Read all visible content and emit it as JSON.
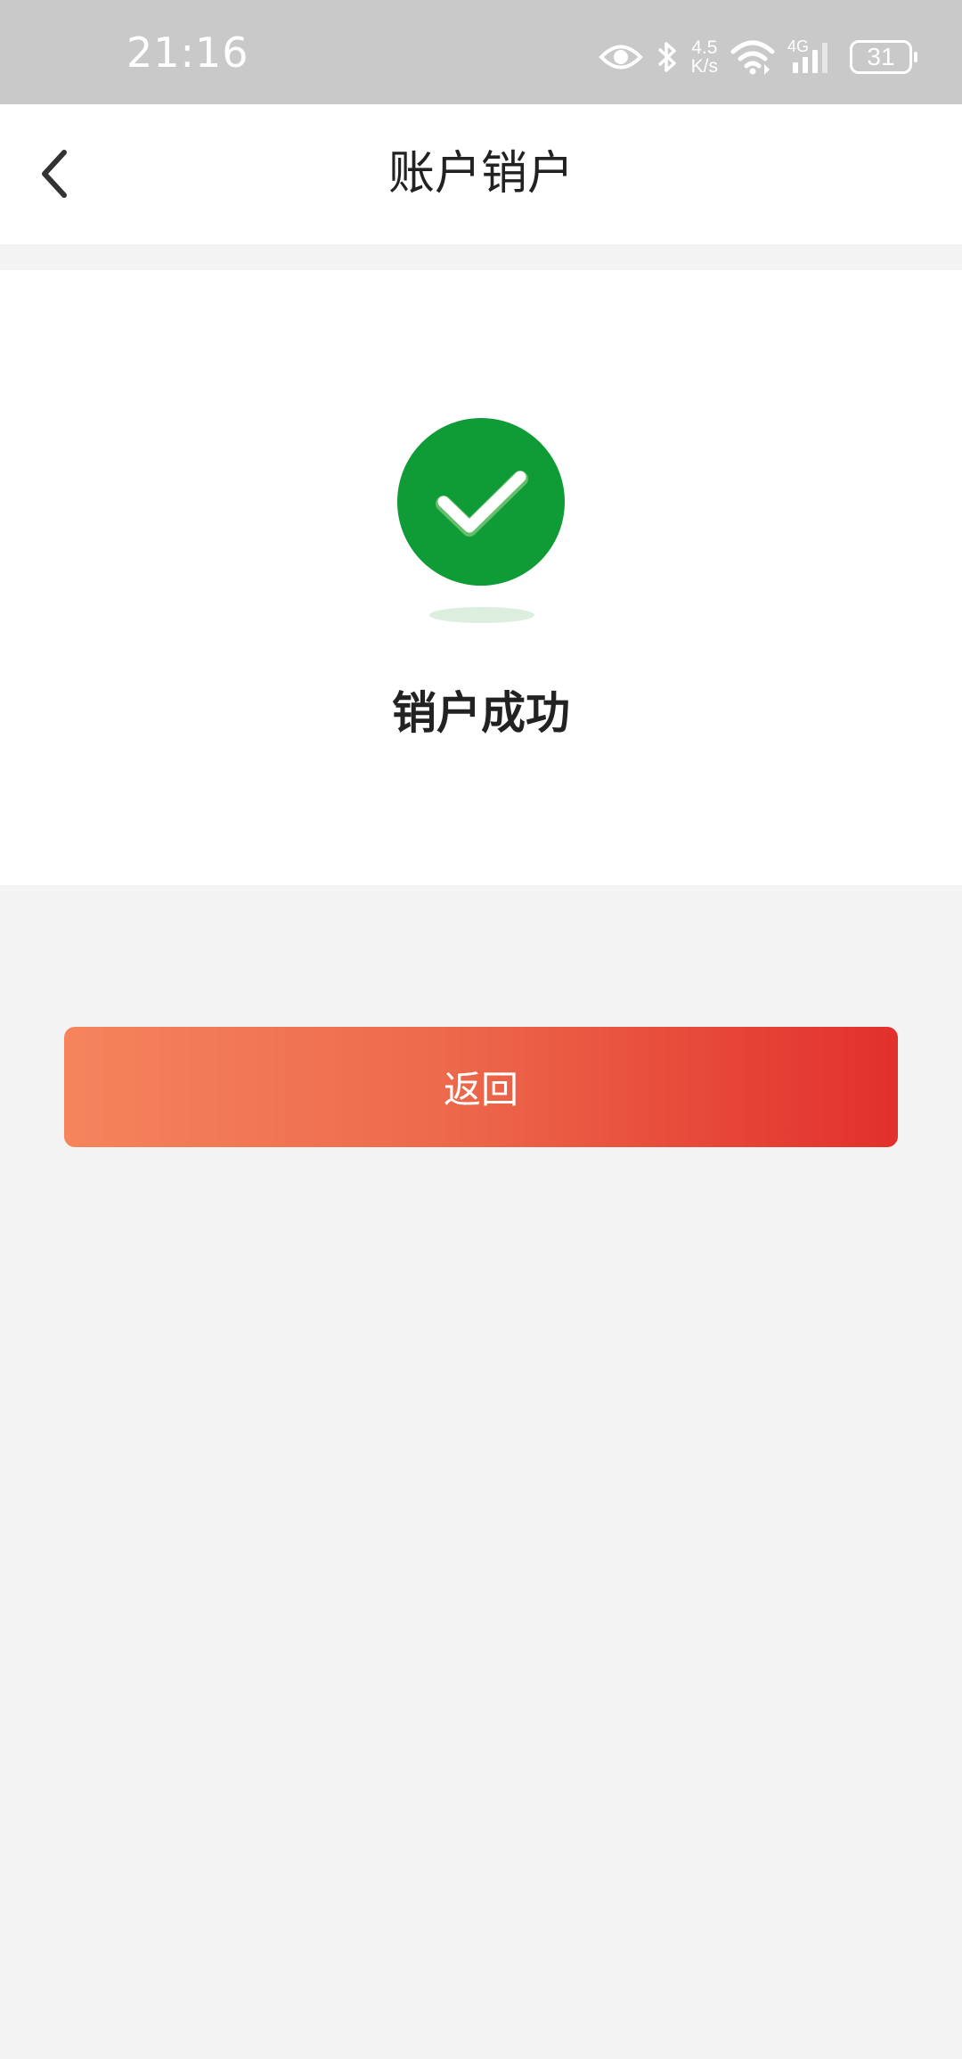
{
  "status_bar": {
    "time": "21:16",
    "net_speed_value": "4.5",
    "net_speed_unit": "K/s",
    "network_type": "4G",
    "battery_level": "31",
    "icons": [
      "eye-icon",
      "bluetooth-icon",
      "wifi-icon",
      "signal-icon",
      "battery-icon"
    ]
  },
  "nav": {
    "title": "账户销户",
    "back_icon": "chevron-left-icon"
  },
  "result": {
    "icon": "check-circle-icon",
    "message": "销户成功",
    "accent_color": "#0f9b35"
  },
  "actions": {
    "return_label": "返回",
    "gradient_start": "#f5845d",
    "gradient_end": "#e2302c"
  }
}
